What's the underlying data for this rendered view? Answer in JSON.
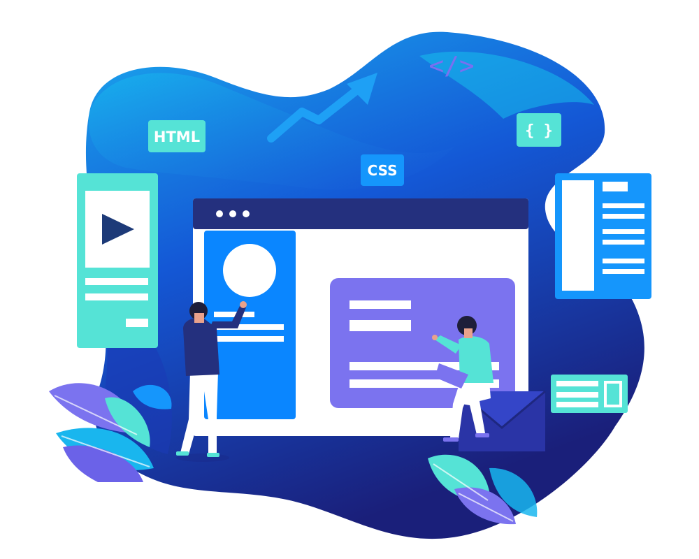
{
  "tags": {
    "html_label": "HTML",
    "css_label": "CSS",
    "braces_label": "{ }",
    "code_label": "</>"
  },
  "icons": {
    "play": "play-icon",
    "trend": "trend-up-arrow-icon",
    "envelope": "envelope-icon",
    "dots": "window-dots-icon",
    "leaves": "leaf-icon"
  },
  "colors": {
    "blob_dark": "#1d2d9c",
    "blob_mid": "#1565e0",
    "blob_light": "#19b6ee",
    "window_bar": "#24307e",
    "sidebar_blue": "#0a86ff",
    "card_purple": "#7b73ef",
    "teal": "#55e3d6",
    "bright_blue": "#1596fc"
  }
}
